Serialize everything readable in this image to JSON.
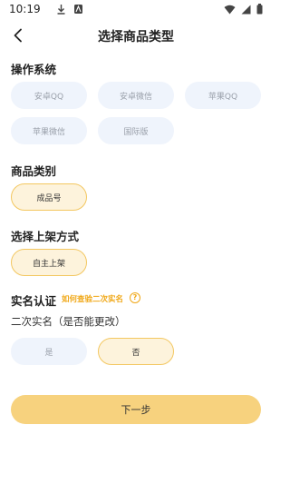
{
  "status_bar": {
    "time": "10:19"
  },
  "header": {
    "title": "选择商品类型"
  },
  "sections": {
    "os": {
      "title": "操作系统",
      "options": [
        {
          "label": "安卓QQ",
          "selected": false
        },
        {
          "label": "安卓微信",
          "selected": false
        },
        {
          "label": "苹果QQ",
          "selected": false
        },
        {
          "label": "苹果微信",
          "selected": false
        },
        {
          "label": "国际版",
          "selected": false
        }
      ]
    },
    "category": {
      "title": "商品类别",
      "options": [
        {
          "label": "成品号",
          "selected": true
        }
      ]
    },
    "listing": {
      "title": "选择上架方式",
      "options": [
        {
          "label": "自主上架",
          "selected": true
        }
      ]
    },
    "verify": {
      "title": "实名认证",
      "link": "如何查验二次实名",
      "help_icon": "?",
      "question": "二次实名（是否能更改）",
      "options": [
        {
          "label": "是",
          "selected": false
        },
        {
          "label": "否",
          "selected": true
        }
      ]
    }
  },
  "footer": {
    "next_label": "下一步"
  },
  "colors": {
    "accent": "#f0a818",
    "chip_bg": "#eff4fc",
    "chip_selected_bg": "#fdf3dc",
    "chip_selected_border": "#f3c760",
    "button_bg": "#f7d27e"
  }
}
